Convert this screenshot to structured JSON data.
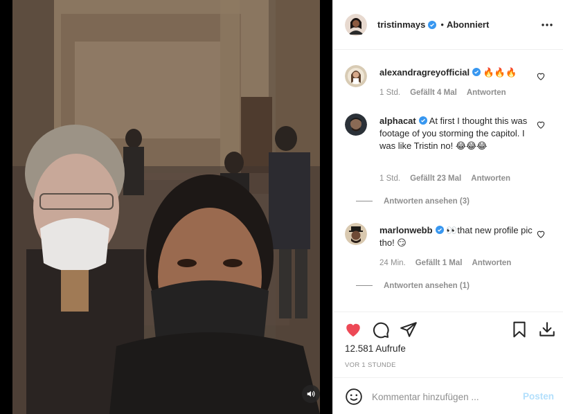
{
  "post": {
    "author": "tristinmays",
    "verified": true,
    "follow_state": "Abonniert",
    "separator": "•"
  },
  "comments": [
    {
      "username": "alexandragreyofficial",
      "verified": true,
      "text": "🔥🔥🔥",
      "time": "1 Std.",
      "likes": "Gefällt 4 Mal",
      "reply": "Antworten"
    },
    {
      "username": "alphacat",
      "verified": true,
      "text": "At first I thought this was footage of you storming the capitol. I was like Tristin no! 😂😂😂",
      "time": "1 Std.",
      "likes": "Gefällt 23 Mal",
      "reply": "Antworten",
      "view_replies": "Antworten ansehen (3)"
    },
    {
      "username": "marlonwebb",
      "verified": true,
      "text": "👀that new profile pic tho! 😏",
      "time": "24 Min.",
      "likes": "Gefällt 1 Mal",
      "reply": "Antworten",
      "view_replies": "Antworten ansehen (1)"
    }
  ],
  "stats": {
    "views": "12.581 Aufrufe",
    "posted": "VOR 1 STUNDE"
  },
  "add_comment": {
    "placeholder": "Kommentar hinzufügen ...",
    "post_label": "Posten"
  },
  "colors": {
    "like_red": "#ed4956",
    "verified_blue": "#3897f0",
    "post_disabled": "#b2dffc",
    "secondary_text": "#8e8e8e"
  },
  "icons": {
    "like": "heart-filled-icon",
    "comment": "speech-bubble-icon",
    "share": "paper-plane-icon",
    "save": "bookmark-icon",
    "download": "download-icon",
    "more": "more-dots-icon",
    "emoji": "smiley-icon",
    "mute": "speaker-icon"
  }
}
